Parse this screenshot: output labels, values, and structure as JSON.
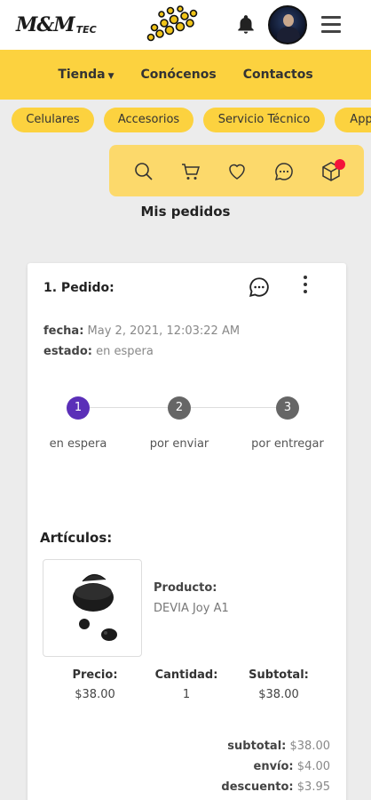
{
  "header": {
    "logo_text": "M&M",
    "logo_sub": "TEC",
    "bell_icon": "bell-icon",
    "avatar_icon": "user-avatar",
    "menu_icon": "hamburger-icon"
  },
  "nav": {
    "items": [
      {
        "label": "Tienda",
        "has_caret": true
      },
      {
        "label": "Conócenos"
      },
      {
        "label": "Contactos"
      }
    ]
  },
  "categories": [
    "Celulares",
    "Accesorios",
    "Servicio Técnico",
    "App"
  ],
  "iconbar": {
    "icons": [
      "search-icon",
      "cart-icon",
      "heart-icon",
      "chat-icon",
      "box-icon"
    ],
    "accent": "#fcd23f",
    "badge_color": "#f4133a"
  },
  "page_title": "Mis pedidos",
  "order": {
    "title": "1. Pedido:",
    "fecha_label": "fecha:",
    "fecha_value": "May 2, 2021, 12:03:22 AM",
    "estado_label": "estado:",
    "estado_value": "en espera",
    "steps": [
      {
        "num": "1",
        "label": "en espera",
        "color": "#5b2fb8"
      },
      {
        "num": "2",
        "label": "por enviar",
        "color": "#666666"
      },
      {
        "num": "3",
        "label": "por entregar",
        "color": "#666666"
      }
    ],
    "articles_title": "Artículos:",
    "product_label": "Producto:",
    "product_value": "DEVIA Joy A1",
    "price_label": "Precio:",
    "price_value": "$38.00",
    "qty_label": "Cantidad:",
    "qty_value": "1",
    "subtotal_label": "Subtotal:",
    "subtotal_value": "$38.00",
    "totals": [
      {
        "label": "subtotal:",
        "value": "$38.00"
      },
      {
        "label": "envío:",
        "value": "$4.00"
      },
      {
        "label": "descuento:",
        "value": "$3.95"
      }
    ]
  }
}
